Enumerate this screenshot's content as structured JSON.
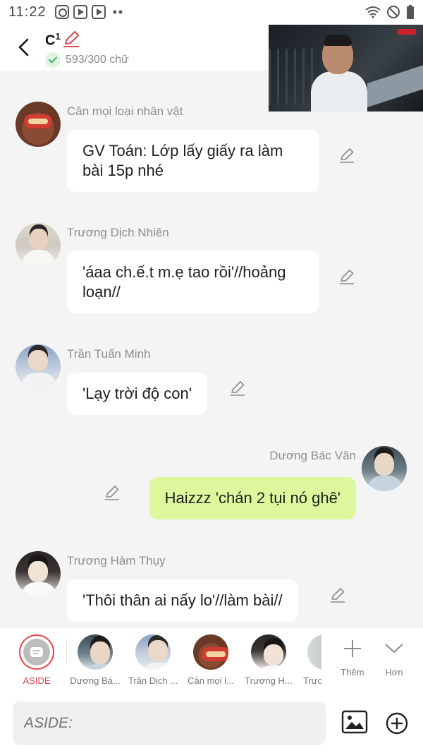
{
  "status_bar": {
    "time": "11:22",
    "icons": [
      "instagram-icon",
      "youtube-icon",
      "youtube-icon"
    ],
    "overflow": "••"
  },
  "header": {
    "title": "C",
    "title_sup": "1",
    "word_count": "593/300 chữ"
  },
  "messages": [
    {
      "sender": "Cân mọi loại nhân vật",
      "text": "GV Toán: Lớp lấy giấy ra làm bài 15p nhé",
      "mine": false
    },
    {
      "sender": "Trương Dịch Nhiên",
      "text": "'áaa ch.ế.t m.ẹ tao rồi'//hoảng loạn//",
      "mine": false
    },
    {
      "sender": "Trần Tuấn Minh",
      "text": "'Lạy trời độ con'",
      "mine": false
    },
    {
      "sender": "Dương Bác Văn",
      "text": "Haizzz 'chán 2 tụi nó ghê'",
      "mine": true
    },
    {
      "sender": "Trương Hàm Thụy",
      "text": "'Thôi thân ai nấy lo'//làm bài//",
      "mine": false
    }
  ],
  "character_bar": {
    "aside_label": "ASIDE",
    "characters": [
      "Dương Bá...",
      "Trần Dịch ...",
      "Cân mọi l...",
      "Trương H...",
      "Trươ"
    ],
    "add_label": "Thêm",
    "more_label": "Hơn"
  },
  "composer": {
    "placeholder": "ASIDE:"
  },
  "colors": {
    "accent": "#e0464d",
    "my_bubble": "#dcf79c",
    "check_bg": "#dff3e2",
    "check": "#3bb266"
  }
}
